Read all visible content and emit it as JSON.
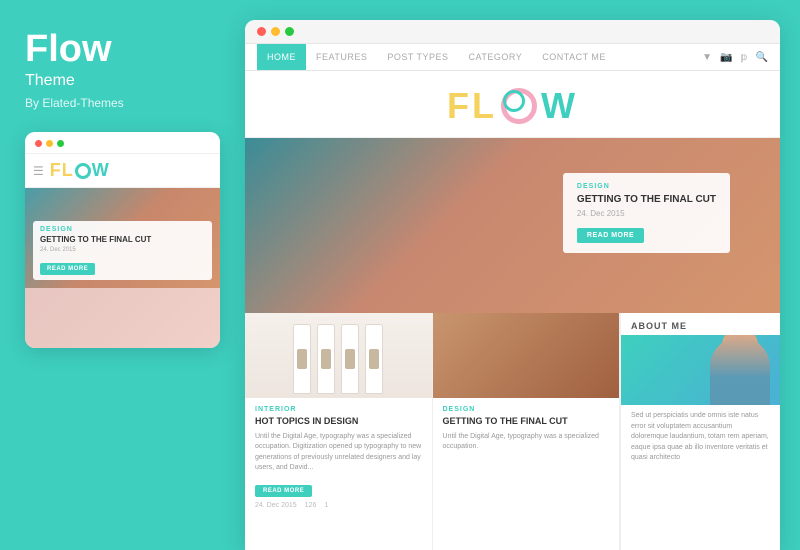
{
  "brand": {
    "title": "Flow",
    "subtitle": "Theme",
    "author": "By Elated-Themes"
  },
  "colors": {
    "teal": "#3ecfbf",
    "yellow": "#f5d25d",
    "pink": "#f4a9c0",
    "red": "#e05a5a"
  },
  "nav": {
    "items": [
      "HOME",
      "FEATURES",
      "POST TYPES",
      "CATEGORY",
      "CONTACT ME"
    ],
    "active": "HOME"
  },
  "hero": {
    "tag": "DESIGN",
    "title": "GETTING TO THE FINAL CUT",
    "date": "24. Dec 2015",
    "btn": "READ MORE"
  },
  "post1": {
    "tag": "INTERIOR",
    "title": "HOT TOPICS IN DESIGN",
    "excerpt": "Until the Digital Age, typography was a specialized occupation. Digitization opened up typography to new generations of previously unrelated designers and lay users, and David...",
    "date": "24. Dec 2015",
    "views": "126",
    "comments": "1",
    "btn": "READ MORE"
  },
  "post2": {
    "tag": "DESIGN",
    "title": "GETTING TO THE FINAL CUT",
    "excerpt": "Until the Digital Age, typography was a specialized occupation."
  },
  "sidebar": {
    "header": "ABOUT ME",
    "text": "Sed ut perspiciatis unde omnis iste natus error sit voluptatem accusantium doloremque laudantium, totam rem aperiam, eaque ipsa quae ab illo inventore veritatis et quasi architecto"
  },
  "phone": {
    "category": "DESIGN",
    "post_title": "GETTING TO THE FINAL CUT",
    "date": "24. Dec 2015",
    "btn": "READ MORE"
  }
}
